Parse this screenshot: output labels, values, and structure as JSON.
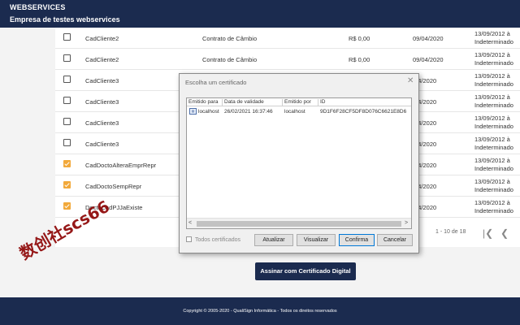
{
  "header": {
    "app_title": "WEBSERVICES",
    "company": "Empresa de testes webservices"
  },
  "table": {
    "rows": [
      {
        "checked": false,
        "name": "CadCliente2",
        "type": "Contrato de Câmbio",
        "value": "R$ 0,00",
        "date": "09/04/2020",
        "end_line1": "13/09/2012 à",
        "end_line2": "Indeterminado"
      },
      {
        "checked": false,
        "name": "CadCliente2",
        "type": "Contrato de Câmbio",
        "value": "R$ 0,00",
        "date": "09/04/2020",
        "end_line1": "13/09/2012 à",
        "end_line2": "Indeterminado"
      },
      {
        "checked": false,
        "name": "CadCliente3",
        "type": "",
        "value": "",
        "date": "/04/2020",
        "end_line1": "13/09/2012 à",
        "end_line2": "Indeterminado"
      },
      {
        "checked": false,
        "name": "CadCliente3",
        "type": "",
        "value": "",
        "date": "/04/2020",
        "end_line1": "13/09/2012 à",
        "end_line2": "Indeterminado"
      },
      {
        "checked": false,
        "name": "CadCliente3",
        "type": "",
        "value": "",
        "date": "/04/2020",
        "end_line1": "13/09/2012 à",
        "end_line2": "Indeterminado"
      },
      {
        "checked": false,
        "name": "CadCliente3",
        "type": "",
        "value": "",
        "date": "/04/2020",
        "end_line1": "13/09/2012 à",
        "end_line2": "Indeterminado"
      },
      {
        "checked": true,
        "name": "CadDoctoAlteraEmprRepr",
        "type": "",
        "value": "",
        "date": "/04/2020",
        "end_line1": "13/09/2012 à",
        "end_line2": "Indeterminado"
      },
      {
        "checked": true,
        "name": "CadDoctoSempRepr",
        "type": "",
        "value": "",
        "date": "/04/2020",
        "end_line1": "13/09/2012 à",
        "end_line2": "Indeterminado"
      },
      {
        "checked": true,
        "name": "DoctoCadPJJaExiste",
        "type": "",
        "value": "",
        "date": "/04/2020",
        "end_line1": "13/09/2012 à",
        "end_line2": "Indeterminado"
      }
    ],
    "pager_text": "1 - 10 de 18",
    "pager_first_icon": "first-page-icon",
    "pager_prev_icon": "chevron-left-icon"
  },
  "sign_button": "Assinar com Certificado Digital",
  "footer": "Copyright © 2005-2020 - QualiSign Informática - Todos os direitos reservados",
  "dialog": {
    "title": "Escolha um certificado",
    "columns": [
      "Emitido para",
      "Data de validade",
      "Emitido por",
      "ID"
    ],
    "certificates": [
      {
        "issued_to": "localhost",
        "valid_until": "26/02/2021 16:37:46",
        "issued_by": "localhost",
        "id": "9D1F6F28CF5DF8D076C6621E8D6"
      }
    ],
    "all_certs_label": "Todos certificados",
    "buttons": {
      "refresh": "Atualizar",
      "view": "Visualizar",
      "confirm": "Confirma",
      "cancel": "Cancelar"
    }
  },
  "watermark": "数创社scs66",
  "colors": {
    "header_bg": "#1b2b4f",
    "checkbox_checked": "#f2a93b",
    "watermark": "#8b0000"
  }
}
